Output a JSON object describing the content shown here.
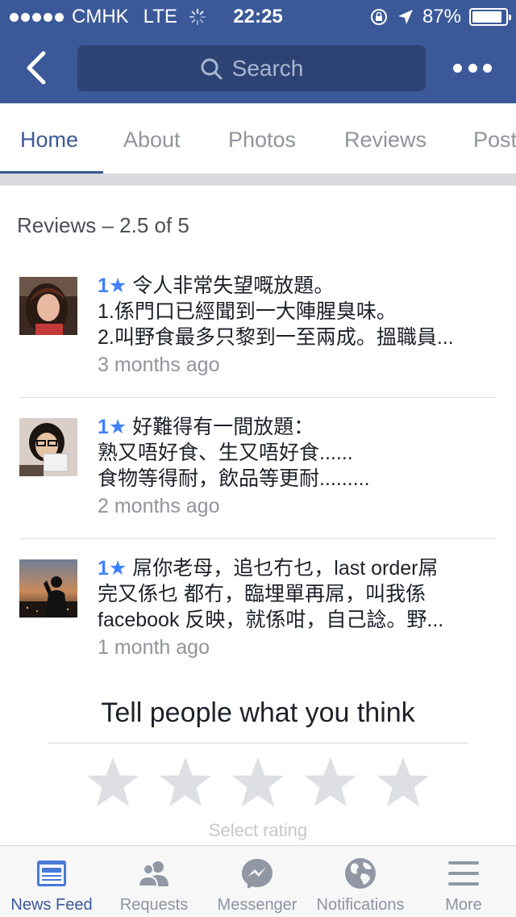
{
  "status_bar": {
    "carrier": "CMHK",
    "network": "LTE",
    "time": "22:25",
    "battery": "87%"
  },
  "header": {
    "search_placeholder": "Search",
    "icons": [
      "back-chevron-icon",
      "search-icon",
      "more-dots-icon"
    ]
  },
  "tabs": [
    "Home",
    "About",
    "Photos",
    "Reviews",
    "Posts"
  ],
  "reviews_title": "Reviews – 2.5 of 5",
  "reviews": [
    {
      "rating": "1",
      "lines": [
        "令人非常失望嘅放題。",
        "1.係門口已經聞到一大陣腥臭味。",
        "2.叫野食最多只黎到一至兩成。搵職員..."
      ],
      "time": "3 months ago"
    },
    {
      "rating": "1",
      "lines": [
        "好難得有一間放題：",
        "熟又唔好食、生又唔好食......",
        "食物等得耐，飲品等更耐........."
      ],
      "time": "2 months ago"
    },
    {
      "rating": "1",
      "lines": [
        "屌你老母，追乜冇乜，last order屌",
        "完又係乜 都冇，臨埋單再屌，叫我係",
        "facebook 反映，就係咁，自己諗。野..."
      ],
      "time": "1 month ago"
    }
  ],
  "tell_prompt": "Tell people what you think",
  "select_rating": "Select rating",
  "bottom_nav": [
    {
      "label": "News Feed",
      "icon": "news-feed-icon",
      "active": true
    },
    {
      "label": "Requests",
      "icon": "requests-icon",
      "active": false
    },
    {
      "label": "Messenger",
      "icon": "messenger-icon",
      "active": false
    },
    {
      "label": "Notifications",
      "icon": "globe-icon",
      "active": false
    },
    {
      "label": "More",
      "icon": "menu-icon",
      "active": false
    }
  ],
  "colors": {
    "brand": "#3b5998",
    "rating_blue": "#4080ff",
    "muted_text": "#90949c",
    "star_empty": "#dddfe2"
  }
}
